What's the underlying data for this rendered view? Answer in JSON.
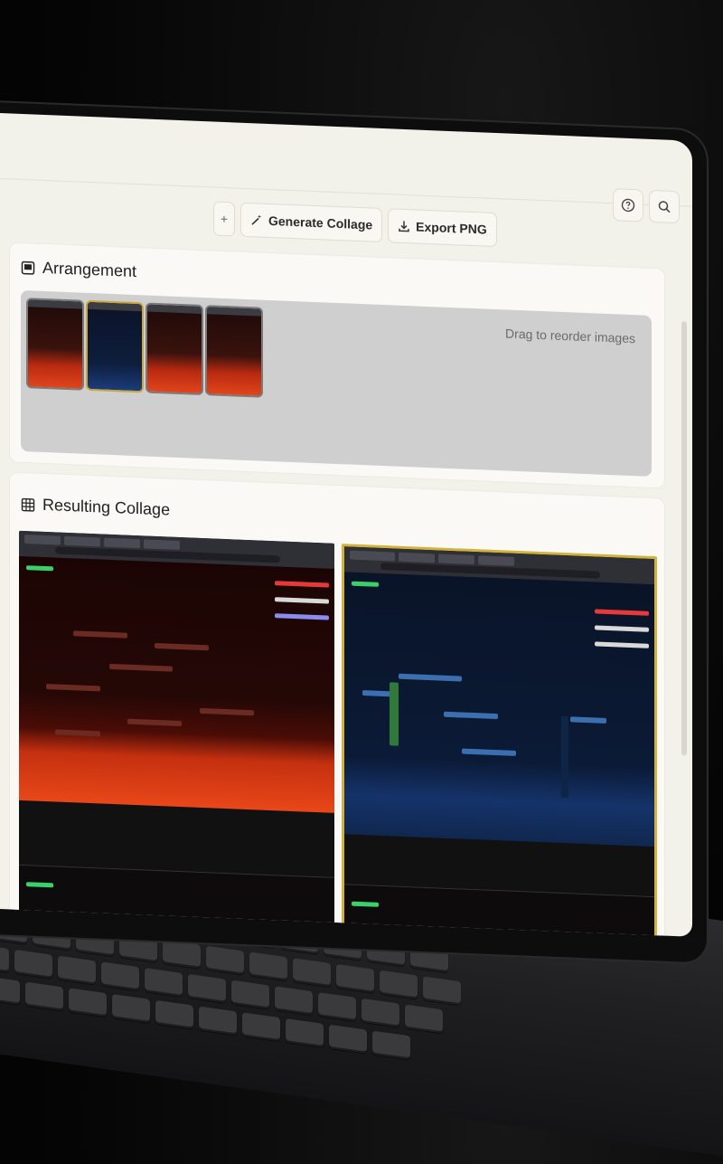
{
  "toolbar": {
    "add_label": "+",
    "generate_label": "Generate Collage",
    "export_label": "Export PNG"
  },
  "header": {
    "help_icon": "help-circle-icon",
    "search_icon": "search-icon"
  },
  "arrangement": {
    "title": "Arrangement",
    "hint": "Drag to reorder images",
    "thumbnails": [
      {
        "theme": "lava"
      },
      {
        "theme": "night"
      },
      {
        "theme": "lava"
      },
      {
        "theme": "lava"
      }
    ]
  },
  "collage": {
    "title": "Resulting Collage"
  },
  "colors": {
    "screen_bg": "#f2f1ea",
    "accent_gold": "#d2b23f",
    "lava": "#e84719"
  }
}
